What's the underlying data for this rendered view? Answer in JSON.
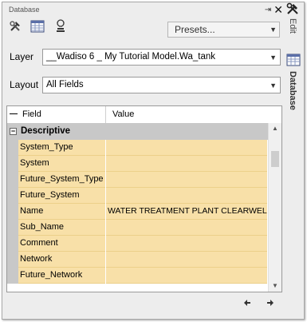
{
  "panel": {
    "title": "Database"
  },
  "window_buttons": {
    "pin": "⇥",
    "close": "✕",
    "tools": "⚒"
  },
  "toolbar": {
    "tools_icon": "tools-icon",
    "table_icon": "table-icon",
    "lamp_icon": "lamp-icon"
  },
  "presets": {
    "label": "Presets...",
    "arrow": "▼"
  },
  "layer": {
    "label": "Layer",
    "value": "__Wadiso 6 _ My Tutorial Model.Wa_tank",
    "arrow": "▼"
  },
  "layout": {
    "label": "Layout",
    "value": "All Fields",
    "arrow": "▼"
  },
  "side_tabs": {
    "edit": "Edit",
    "database": "Database"
  },
  "grid": {
    "header_toggle": "—",
    "field_header": "Field",
    "value_header": "Value",
    "category": {
      "toggle": "−",
      "label": "Descriptive"
    },
    "rows": [
      {
        "field": "System_Type",
        "value": ""
      },
      {
        "field": "System",
        "value": ""
      },
      {
        "field": "Future_System_Type",
        "value": ""
      },
      {
        "field": "Future_System",
        "value": ""
      },
      {
        "field": "Name",
        "value": "WATER TREATMENT PLANT CLEARWELL"
      },
      {
        "field": "Sub_Name",
        "value": ""
      },
      {
        "field": "Comment",
        "value": ""
      },
      {
        "field": "Network",
        "value": ""
      },
      {
        "field": "Future_Network",
        "value": ""
      }
    ],
    "scroll_up": "▲",
    "scroll_down": "▼"
  },
  "navigation": {
    "prev": "◆",
    "next": "◆"
  },
  "colors": {
    "field_bg": "#f8e0a8",
    "gutter": "#c8c8c8",
    "panel": "#ededed"
  }
}
